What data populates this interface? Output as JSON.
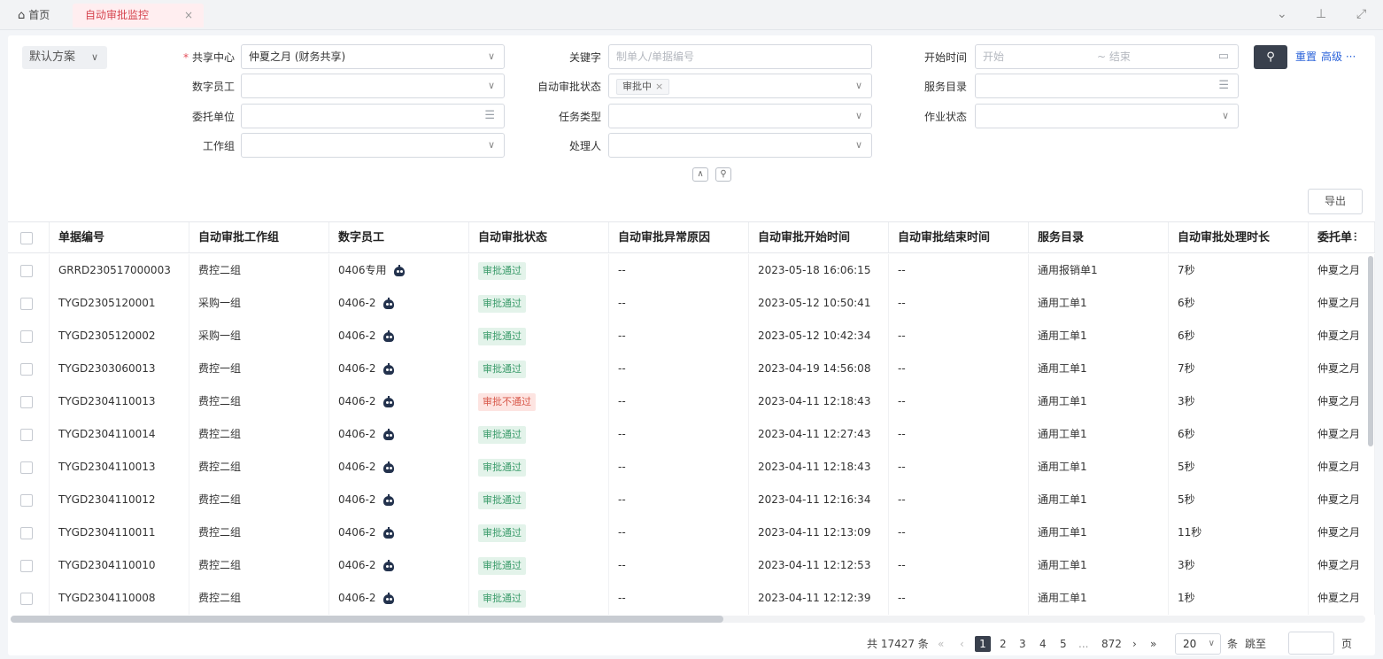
{
  "tabs": {
    "home_label": "首页",
    "active_label": "自动审批监控",
    "close_symbol": "×"
  },
  "toolbar": {
    "scheme_label": "默认方案"
  },
  "filters": {
    "shared_center_label": "共享中心",
    "shared_center_value": "仲夏之月 (财务共享)",
    "keyword_label": "关键字",
    "keyword_placeholder": "制单人/单据编号",
    "start_time_label": "开始时间",
    "start_placeholder": "开始",
    "end_placeholder": "~ 结束",
    "digital_employee_label": "数字员工",
    "auto_status_label": "自动审批状态",
    "auto_status_tag": "审批中",
    "service_catalog_label": "服务目录",
    "delegate_unit_label": "委托单位",
    "task_type_label": "任务类型",
    "job_status_label": "作业状态",
    "work_group_label": "工作组",
    "handler_label": "处理人"
  },
  "actions": {
    "reset_label": "重置",
    "advanced_label": "高级 ···",
    "export_label": "导出"
  },
  "table": {
    "headers": [
      "单据编号",
      "自动审批工作组",
      "数字员工",
      "自动审批状态",
      "自动审批异常原因",
      "自动审批开始时间",
      "自动审批结束时间",
      "服务目录",
      "自动审批处理时长",
      "委托单"
    ],
    "rows": [
      {
        "id": "GRRD230517000003",
        "group": "费控二组",
        "employee": "0406专用",
        "status": "审批通过",
        "status_type": "ok",
        "reason": "--",
        "start": "2023-05-18 16:06:15",
        "end": "--",
        "catalog": "通用报销单1",
        "duration": "7秒",
        "unit": "仲夏之月"
      },
      {
        "id": "TYGD2305120001",
        "group": "采购一组",
        "employee": "0406-2",
        "status": "审批通过",
        "status_type": "ok",
        "reason": "--",
        "start": "2023-05-12 10:50:41",
        "end": "--",
        "catalog": "通用工单1",
        "duration": "6秒",
        "unit": "仲夏之月"
      },
      {
        "id": "TYGD2305120002",
        "group": "采购一组",
        "employee": "0406-2",
        "status": "审批通过",
        "status_type": "ok",
        "reason": "--",
        "start": "2023-05-12 10:42:34",
        "end": "--",
        "catalog": "通用工单1",
        "duration": "6秒",
        "unit": "仲夏之月"
      },
      {
        "id": "TYGD2303060013",
        "group": "费控一组",
        "employee": "0406-2",
        "status": "审批通过",
        "status_type": "ok",
        "reason": "--",
        "start": "2023-04-19 14:56:08",
        "end": "--",
        "catalog": "通用工单1",
        "duration": "7秒",
        "unit": "仲夏之月"
      },
      {
        "id": "TYGD2304110013",
        "group": "费控二组",
        "employee": "0406-2",
        "status": "审批不通过",
        "status_type": "fail",
        "reason": "--",
        "start": "2023-04-11 12:18:43",
        "end": "--",
        "catalog": "通用工单1",
        "duration": "3秒",
        "unit": "仲夏之月"
      },
      {
        "id": "TYGD2304110014",
        "group": "费控二组",
        "employee": "0406-2",
        "status": "审批通过",
        "status_type": "ok",
        "reason": "--",
        "start": "2023-04-11 12:27:43",
        "end": "--",
        "catalog": "通用工单1",
        "duration": "6秒",
        "unit": "仲夏之月"
      },
      {
        "id": "TYGD2304110013",
        "group": "费控二组",
        "employee": "0406-2",
        "status": "审批通过",
        "status_type": "ok",
        "reason": "--",
        "start": "2023-04-11 12:18:43",
        "end": "--",
        "catalog": "通用工单1",
        "duration": "5秒",
        "unit": "仲夏之月"
      },
      {
        "id": "TYGD2304110012",
        "group": "费控二组",
        "employee": "0406-2",
        "status": "审批通过",
        "status_type": "ok",
        "reason": "--",
        "start": "2023-04-11 12:16:34",
        "end": "--",
        "catalog": "通用工单1",
        "duration": "5秒",
        "unit": "仲夏之月"
      },
      {
        "id": "TYGD2304110011",
        "group": "费控二组",
        "employee": "0406-2",
        "status": "审批通过",
        "status_type": "ok",
        "reason": "--",
        "start": "2023-04-11 12:13:09",
        "end": "--",
        "catalog": "通用工单1",
        "duration": "11秒",
        "unit": "仲夏之月"
      },
      {
        "id": "TYGD2304110010",
        "group": "费控二组",
        "employee": "0406-2",
        "status": "审批通过",
        "status_type": "ok",
        "reason": "--",
        "start": "2023-04-11 12:12:53",
        "end": "--",
        "catalog": "通用工单1",
        "duration": "3秒",
        "unit": "仲夏之月"
      },
      {
        "id": "TYGD2304110008",
        "group": "费控二组",
        "employee": "0406-2",
        "status": "审批通过",
        "status_type": "ok",
        "reason": "--",
        "start": "2023-04-11 12:12:39",
        "end": "--",
        "catalog": "通用工单1",
        "duration": "1秒",
        "unit": "仲夏之月"
      }
    ]
  },
  "pagination": {
    "total_text": "共 17427 条",
    "pages": [
      "2",
      "3",
      "4",
      "5"
    ],
    "current_page": "1",
    "ellipsis": "...",
    "last_page": "872",
    "page_size": "20",
    "size_suffix": "条",
    "jump_label": "跳至",
    "page_suffix": "页"
  },
  "colors": {
    "accent_dark": "#39404d",
    "link_blue": "#2b63d9",
    "active_tab_red": "#d6454f",
    "status_ok": "#3a9b6a",
    "status_fail": "#d8584a"
  }
}
